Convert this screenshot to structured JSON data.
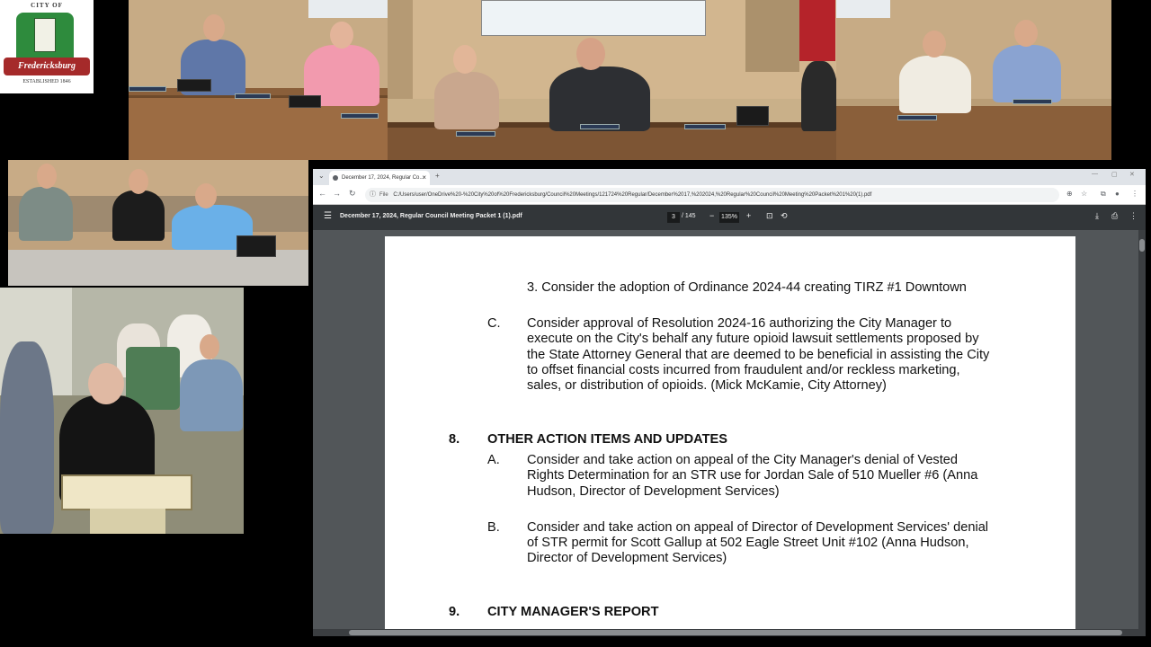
{
  "logo": {
    "arc_text": "CITY OF",
    "ribbon_text": "Fredericksburg",
    "est_text": "ESTABLISHED 1846"
  },
  "browser": {
    "tab_title": "December 17, 2024, Regular Co...",
    "url_label": "File",
    "url": "C:/Users/user/OneDrive%20-%20City%20of%20Fredericksburg/Council%20Meetings/121724%20Regular/December%2017,%202024,%20Regular%20Council%20Meeting%20Packet%201%20(1).pdf"
  },
  "pdf": {
    "title": "December 17, 2024, Regular Council Meeting Packet 1 (1).pdf",
    "page": "3",
    "total": "/ 145",
    "zoom": "135%"
  },
  "document": {
    "item3": "3. Consider the adoption of Ordinance 2024-44 creating TIRZ #1 Downtown",
    "c_letter": "C.",
    "c_lines": [
      "Consider approval of Resolution 2024-16 authorizing the City Manager to",
      "execute on the City's behalf any future opioid lawsuit settlements proposed by",
      "the State Attorney General that are deemed to be beneficial in assisting the City",
      "to offset financial costs incurred from fraudulent and/or reckless marketing,",
      "sales, or distribution of opioids. (Mick McKamie, City Attorney)"
    ],
    "sec8_num": "8.",
    "sec8_title": "OTHER ACTION ITEMS AND UPDATES",
    "a_letter": "A.",
    "a_lines": [
      "Consider and take action on appeal of  the City Manager's denial of Vested",
      "Rights Determination for an STR use for Jordan Sale of 510 Mueller #6 (Anna",
      "Hudson, Director of Development Services)"
    ],
    "b_letter": "B.",
    "b_lines": [
      "Consider and take action on appeal of Director of Development Services' denial",
      "of STR permit for Scott Gallup at 502 Eagle Street Unit #102 (Anna Hudson,",
      "Director of Development Services)"
    ],
    "sec9_num": "9.",
    "sec9_title": "CITY MANAGER'S REPORT"
  }
}
